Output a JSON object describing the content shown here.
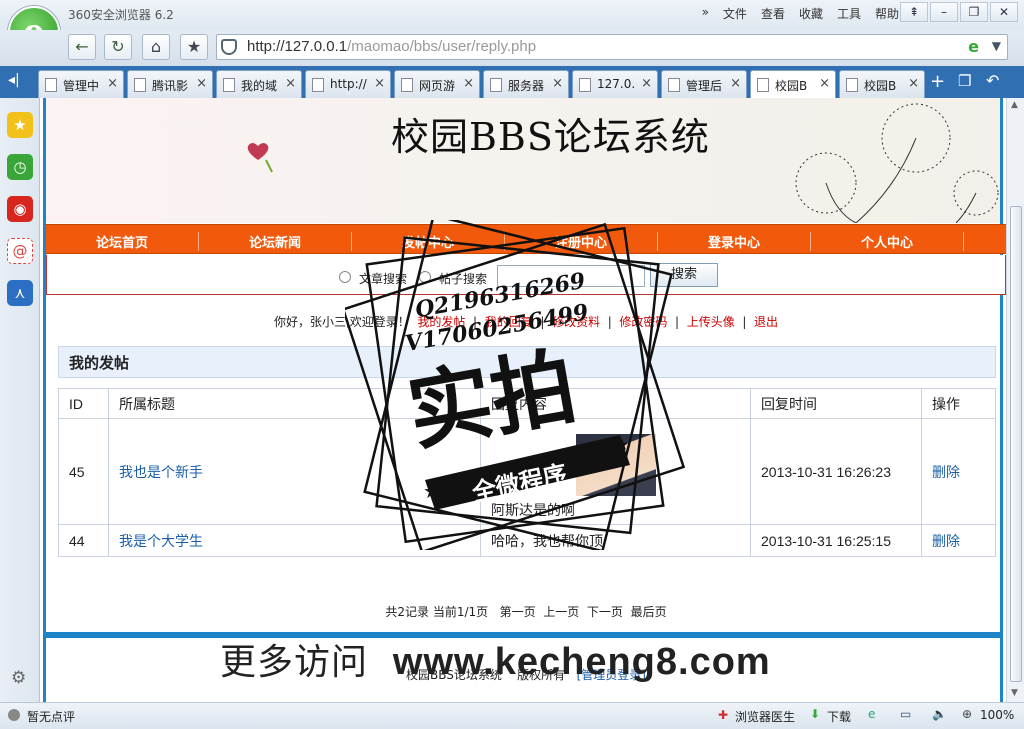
{
  "browser": {
    "title": "360安全浏览器 6.2",
    "menus": [
      "文件",
      "查看",
      "收藏",
      "工具",
      "帮助"
    ],
    "url_host": "http://127.0.0.1",
    "url_path": "/maomao/bbs/user/reply.php",
    "tabs": [
      "管理中",
      "腾讯影",
      "我的域",
      "http://",
      "网页游",
      "服务器",
      "127.0.",
      "管理后",
      "校园B",
      "校园B"
    ],
    "status_left": "暂无点评",
    "status_items": [
      "浏览器医生",
      "下载"
    ],
    "zoom": "100%"
  },
  "site": {
    "title": "校园BBS论坛系统",
    "nav": [
      "论坛首页",
      "论坛新闻",
      "发帖中心",
      "注册中心",
      "登录中心",
      "个人中心"
    ],
    "search_options": [
      "文章搜索",
      "帖子搜索"
    ],
    "search_button": "搜索",
    "welcome": "你好，张小三,欢迎登录！",
    "user_links": [
      "我的发帖",
      "我的回复",
      "修改资料",
      "修改密码",
      "上传头像",
      "退出"
    ],
    "panel_title": "我的发帖",
    "table": {
      "headers": [
        "ID",
        "所属标题",
        "回复内容",
        "回复时间",
        "操作"
      ],
      "rows": [
        {
          "id": "45",
          "title": "我也是个新手",
          "content": "阿斯达是的啊",
          "time": "2013-10-31 16:26:23",
          "action": "删除"
        },
        {
          "id": "44",
          "title": "我是个大学生",
          "content": "哈哈，我也帮你顶",
          "time": "2013-10-31 16:25:15",
          "action": "删除"
        }
      ]
    },
    "pager": {
      "summary": "共2记录 当前1/1页",
      "links": [
        "第一页",
        "上一页",
        "下一页",
        "最后页"
      ]
    },
    "footer": {
      "text": "校园BBS论坛系统",
      "rights": "版权所有",
      "admin_link": "[管理员登录]"
    }
  },
  "overlay": {
    "watermark_cn": "更多访问",
    "watermark_url": "www.kecheng8.com",
    "stamp_qq": "Q2196316269",
    "stamp_v": "V17060256499",
    "stamp_big": "实拍",
    "stamp_ribbon": "全微程序"
  }
}
